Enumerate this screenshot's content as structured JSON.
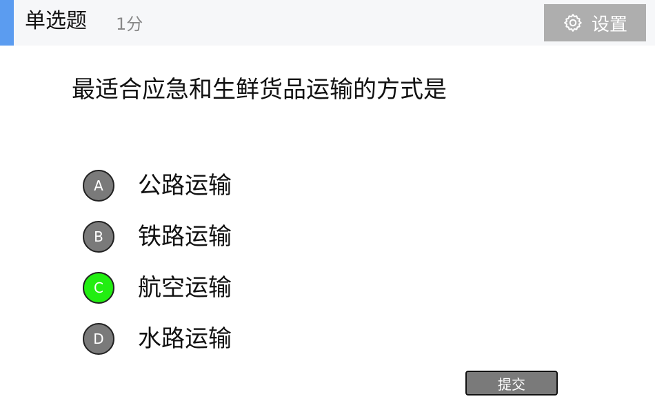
{
  "header": {
    "question_type": "单选题",
    "score": "1分",
    "settings_label": "设置",
    "settings_icon": "gear-icon",
    "accent_color": "#5b9cf0"
  },
  "question": {
    "text": "最适合应急和生鲜货品运输的方式是"
  },
  "options": [
    {
      "letter": "A",
      "label": "公路运输",
      "selected": false
    },
    {
      "letter": "B",
      "label": "铁路运输",
      "selected": false
    },
    {
      "letter": "C",
      "label": "航空运输",
      "selected": true
    },
    {
      "letter": "D",
      "label": "水路运输",
      "selected": false
    }
  ],
  "colors": {
    "option_default": "#7a7a7a",
    "option_selected": "#22ee11"
  },
  "submit": {
    "label": "提交"
  }
}
